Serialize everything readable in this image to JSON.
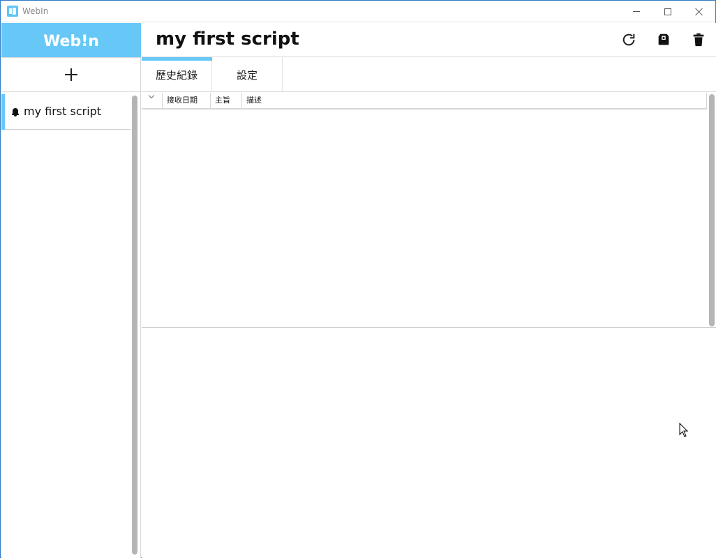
{
  "window": {
    "title": "WebIn"
  },
  "sidebar": {
    "brand": "Web!n",
    "items": [
      {
        "label": "my first script",
        "icon": "bell-icon",
        "selected": true
      }
    ]
  },
  "main": {
    "title": "my first script",
    "header_icons": [
      "refresh-icon",
      "archive-icon",
      "trash-icon"
    ],
    "tabs": [
      {
        "label": "歷史紀錄",
        "active": true
      },
      {
        "label": "設定",
        "active": false
      }
    ],
    "table": {
      "columns": [
        "接收日期",
        "主旨",
        "描述"
      ],
      "rows": []
    }
  },
  "colors": {
    "accent": "#67c8f8",
    "window_border": "#2b7bc4",
    "scrollbar": "#b5b5b5"
  }
}
